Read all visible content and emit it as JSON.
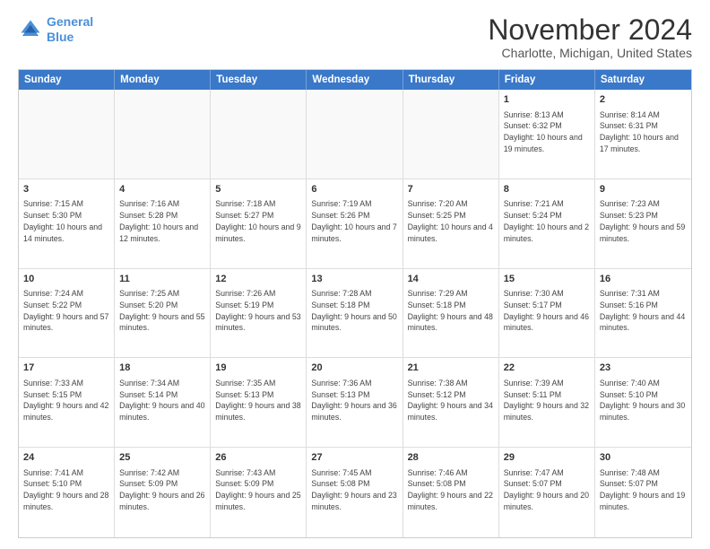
{
  "header": {
    "logo_line1": "General",
    "logo_line2": "Blue",
    "month_title": "November 2024",
    "location": "Charlotte, Michigan, United States"
  },
  "calendar": {
    "days_of_week": [
      "Sunday",
      "Monday",
      "Tuesday",
      "Wednesday",
      "Thursday",
      "Friday",
      "Saturday"
    ],
    "weeks": [
      [
        {
          "day": "",
          "info": ""
        },
        {
          "day": "",
          "info": ""
        },
        {
          "day": "",
          "info": ""
        },
        {
          "day": "",
          "info": ""
        },
        {
          "day": "",
          "info": ""
        },
        {
          "day": "1",
          "info": "Sunrise: 8:13 AM\nSunset: 6:32 PM\nDaylight: 10 hours and 19 minutes."
        },
        {
          "day": "2",
          "info": "Sunrise: 8:14 AM\nSunset: 6:31 PM\nDaylight: 10 hours and 17 minutes."
        }
      ],
      [
        {
          "day": "3",
          "info": "Sunrise: 7:15 AM\nSunset: 5:30 PM\nDaylight: 10 hours and 14 minutes."
        },
        {
          "day": "4",
          "info": "Sunrise: 7:16 AM\nSunset: 5:28 PM\nDaylight: 10 hours and 12 minutes."
        },
        {
          "day": "5",
          "info": "Sunrise: 7:18 AM\nSunset: 5:27 PM\nDaylight: 10 hours and 9 minutes."
        },
        {
          "day": "6",
          "info": "Sunrise: 7:19 AM\nSunset: 5:26 PM\nDaylight: 10 hours and 7 minutes."
        },
        {
          "day": "7",
          "info": "Sunrise: 7:20 AM\nSunset: 5:25 PM\nDaylight: 10 hours and 4 minutes."
        },
        {
          "day": "8",
          "info": "Sunrise: 7:21 AM\nSunset: 5:24 PM\nDaylight: 10 hours and 2 minutes."
        },
        {
          "day": "9",
          "info": "Sunrise: 7:23 AM\nSunset: 5:23 PM\nDaylight: 9 hours and 59 minutes."
        }
      ],
      [
        {
          "day": "10",
          "info": "Sunrise: 7:24 AM\nSunset: 5:22 PM\nDaylight: 9 hours and 57 minutes."
        },
        {
          "day": "11",
          "info": "Sunrise: 7:25 AM\nSunset: 5:20 PM\nDaylight: 9 hours and 55 minutes."
        },
        {
          "day": "12",
          "info": "Sunrise: 7:26 AM\nSunset: 5:19 PM\nDaylight: 9 hours and 53 minutes."
        },
        {
          "day": "13",
          "info": "Sunrise: 7:28 AM\nSunset: 5:18 PM\nDaylight: 9 hours and 50 minutes."
        },
        {
          "day": "14",
          "info": "Sunrise: 7:29 AM\nSunset: 5:18 PM\nDaylight: 9 hours and 48 minutes."
        },
        {
          "day": "15",
          "info": "Sunrise: 7:30 AM\nSunset: 5:17 PM\nDaylight: 9 hours and 46 minutes."
        },
        {
          "day": "16",
          "info": "Sunrise: 7:31 AM\nSunset: 5:16 PM\nDaylight: 9 hours and 44 minutes."
        }
      ],
      [
        {
          "day": "17",
          "info": "Sunrise: 7:33 AM\nSunset: 5:15 PM\nDaylight: 9 hours and 42 minutes."
        },
        {
          "day": "18",
          "info": "Sunrise: 7:34 AM\nSunset: 5:14 PM\nDaylight: 9 hours and 40 minutes."
        },
        {
          "day": "19",
          "info": "Sunrise: 7:35 AM\nSunset: 5:13 PM\nDaylight: 9 hours and 38 minutes."
        },
        {
          "day": "20",
          "info": "Sunrise: 7:36 AM\nSunset: 5:13 PM\nDaylight: 9 hours and 36 minutes."
        },
        {
          "day": "21",
          "info": "Sunrise: 7:38 AM\nSunset: 5:12 PM\nDaylight: 9 hours and 34 minutes."
        },
        {
          "day": "22",
          "info": "Sunrise: 7:39 AM\nSunset: 5:11 PM\nDaylight: 9 hours and 32 minutes."
        },
        {
          "day": "23",
          "info": "Sunrise: 7:40 AM\nSunset: 5:10 PM\nDaylight: 9 hours and 30 minutes."
        }
      ],
      [
        {
          "day": "24",
          "info": "Sunrise: 7:41 AM\nSunset: 5:10 PM\nDaylight: 9 hours and 28 minutes."
        },
        {
          "day": "25",
          "info": "Sunrise: 7:42 AM\nSunset: 5:09 PM\nDaylight: 9 hours and 26 minutes."
        },
        {
          "day": "26",
          "info": "Sunrise: 7:43 AM\nSunset: 5:09 PM\nDaylight: 9 hours and 25 minutes."
        },
        {
          "day": "27",
          "info": "Sunrise: 7:45 AM\nSunset: 5:08 PM\nDaylight: 9 hours and 23 minutes."
        },
        {
          "day": "28",
          "info": "Sunrise: 7:46 AM\nSunset: 5:08 PM\nDaylight: 9 hours and 22 minutes."
        },
        {
          "day": "29",
          "info": "Sunrise: 7:47 AM\nSunset: 5:07 PM\nDaylight: 9 hours and 20 minutes."
        },
        {
          "day": "30",
          "info": "Sunrise: 7:48 AM\nSunset: 5:07 PM\nDaylight: 9 hours and 19 minutes."
        }
      ]
    ]
  }
}
